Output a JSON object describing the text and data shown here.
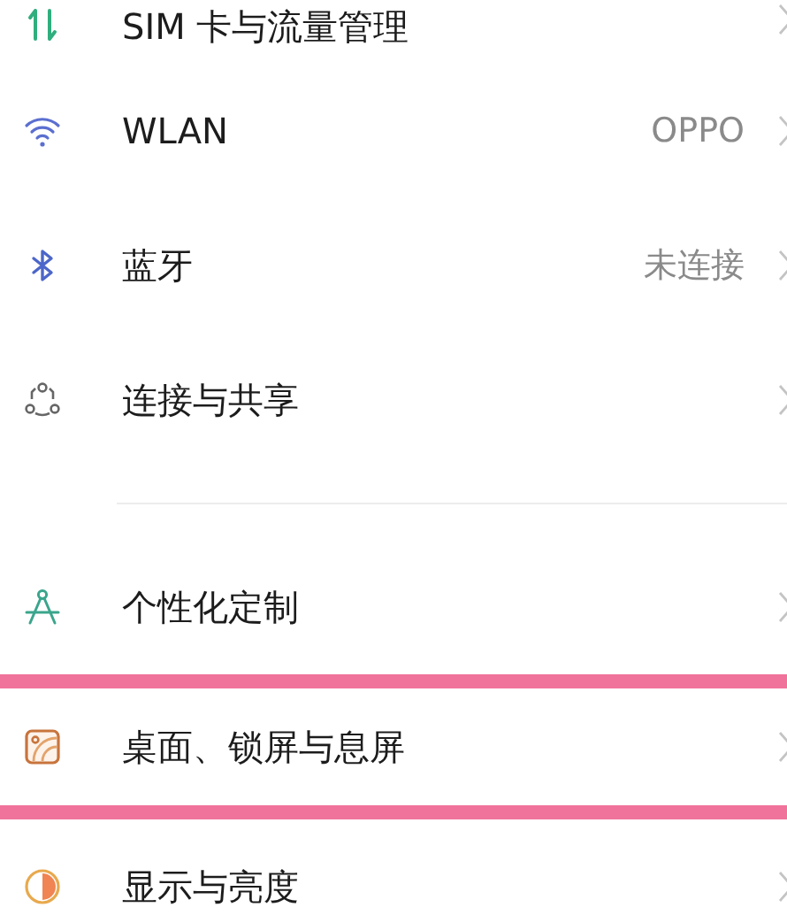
{
  "groups": [
    {
      "items": [
        {
          "kind": "sim",
          "label": "SIM 卡与流量管理",
          "highlighted": false
        },
        {
          "kind": "wifi",
          "label": "WLAN",
          "value": "OPPO",
          "highlighted": false
        },
        {
          "kind": "bluetooth",
          "label": "蓝牙",
          "value": "未连接",
          "highlighted": false
        },
        {
          "kind": "share",
          "label": "连接与共享",
          "highlighted": false
        }
      ]
    },
    {
      "items": [
        {
          "kind": "personal",
          "label": "个性化定制",
          "highlighted": false
        },
        {
          "kind": "wallpaper",
          "label": "桌面、锁屏与息屏",
          "highlighted": true
        },
        {
          "kind": "display",
          "label": "显示与亮度",
          "highlighted": false
        }
      ]
    }
  ]
}
